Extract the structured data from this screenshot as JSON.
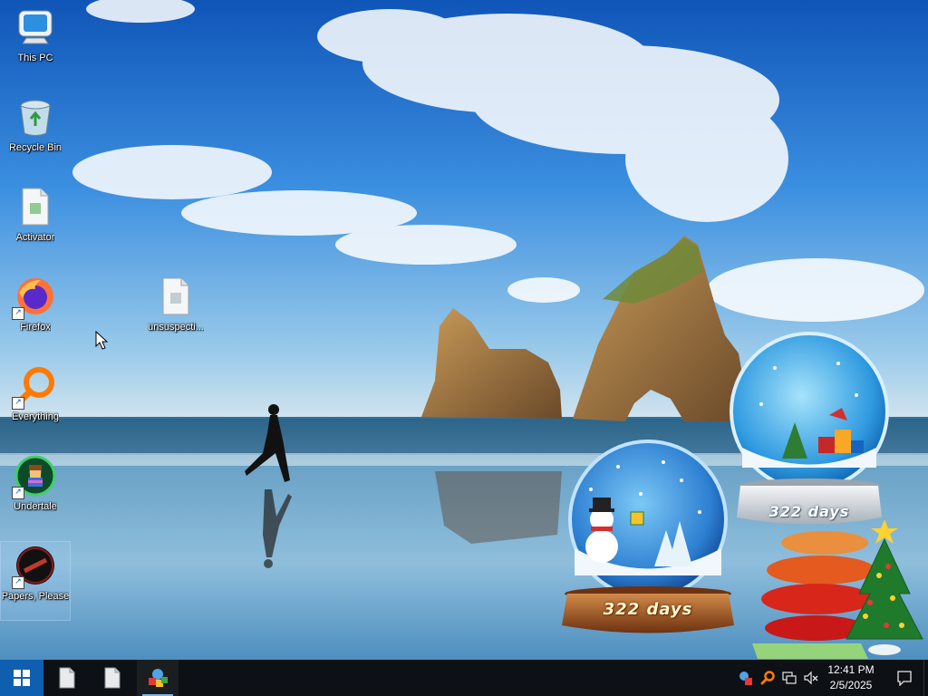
{
  "desktop": {
    "icons": [
      {
        "label": "This PC",
        "icon": "computer-icon"
      },
      {
        "label": "Recycle Bin",
        "icon": "recycle-bin-icon"
      },
      {
        "label": "Activator",
        "icon": "file-icon"
      },
      {
        "label": "Firefox",
        "icon": "firefox-icon",
        "shortcut": true
      },
      {
        "label": "unsuspecti...",
        "icon": "file-icon"
      },
      {
        "label": "Everything",
        "icon": "everything-search-icon",
        "shortcut": true
      },
      {
        "label": "Undertale",
        "icon": "undertale-icon",
        "shortcut": true
      },
      {
        "label": "Papers, Please",
        "icon": "papers-please-icon",
        "shortcut": true,
        "selected": true
      }
    ]
  },
  "widgets": {
    "globe_large": {
      "days": "322 days"
    },
    "globe_small": {
      "days": "322 days"
    }
  },
  "taskbar": {
    "start_icon": "windows-logo-icon",
    "apps": [
      {
        "icon": "file-icon"
      },
      {
        "icon": "file-icon"
      },
      {
        "icon": "application-icon",
        "active": true
      }
    ],
    "tray": {
      "icons": [
        "app-tray-icon",
        "everything-search-icon",
        "network-icon",
        "volume-muted-icon"
      ],
      "time": "12:41 PM",
      "date": "2/5/2025",
      "notification_icon": "notification-icon"
    }
  },
  "colors": {
    "start_blue": "#0e5fb0",
    "taskbar_bg": "#0d1014",
    "sky_top": "#1565c8",
    "sea": "#3f86b8"
  }
}
